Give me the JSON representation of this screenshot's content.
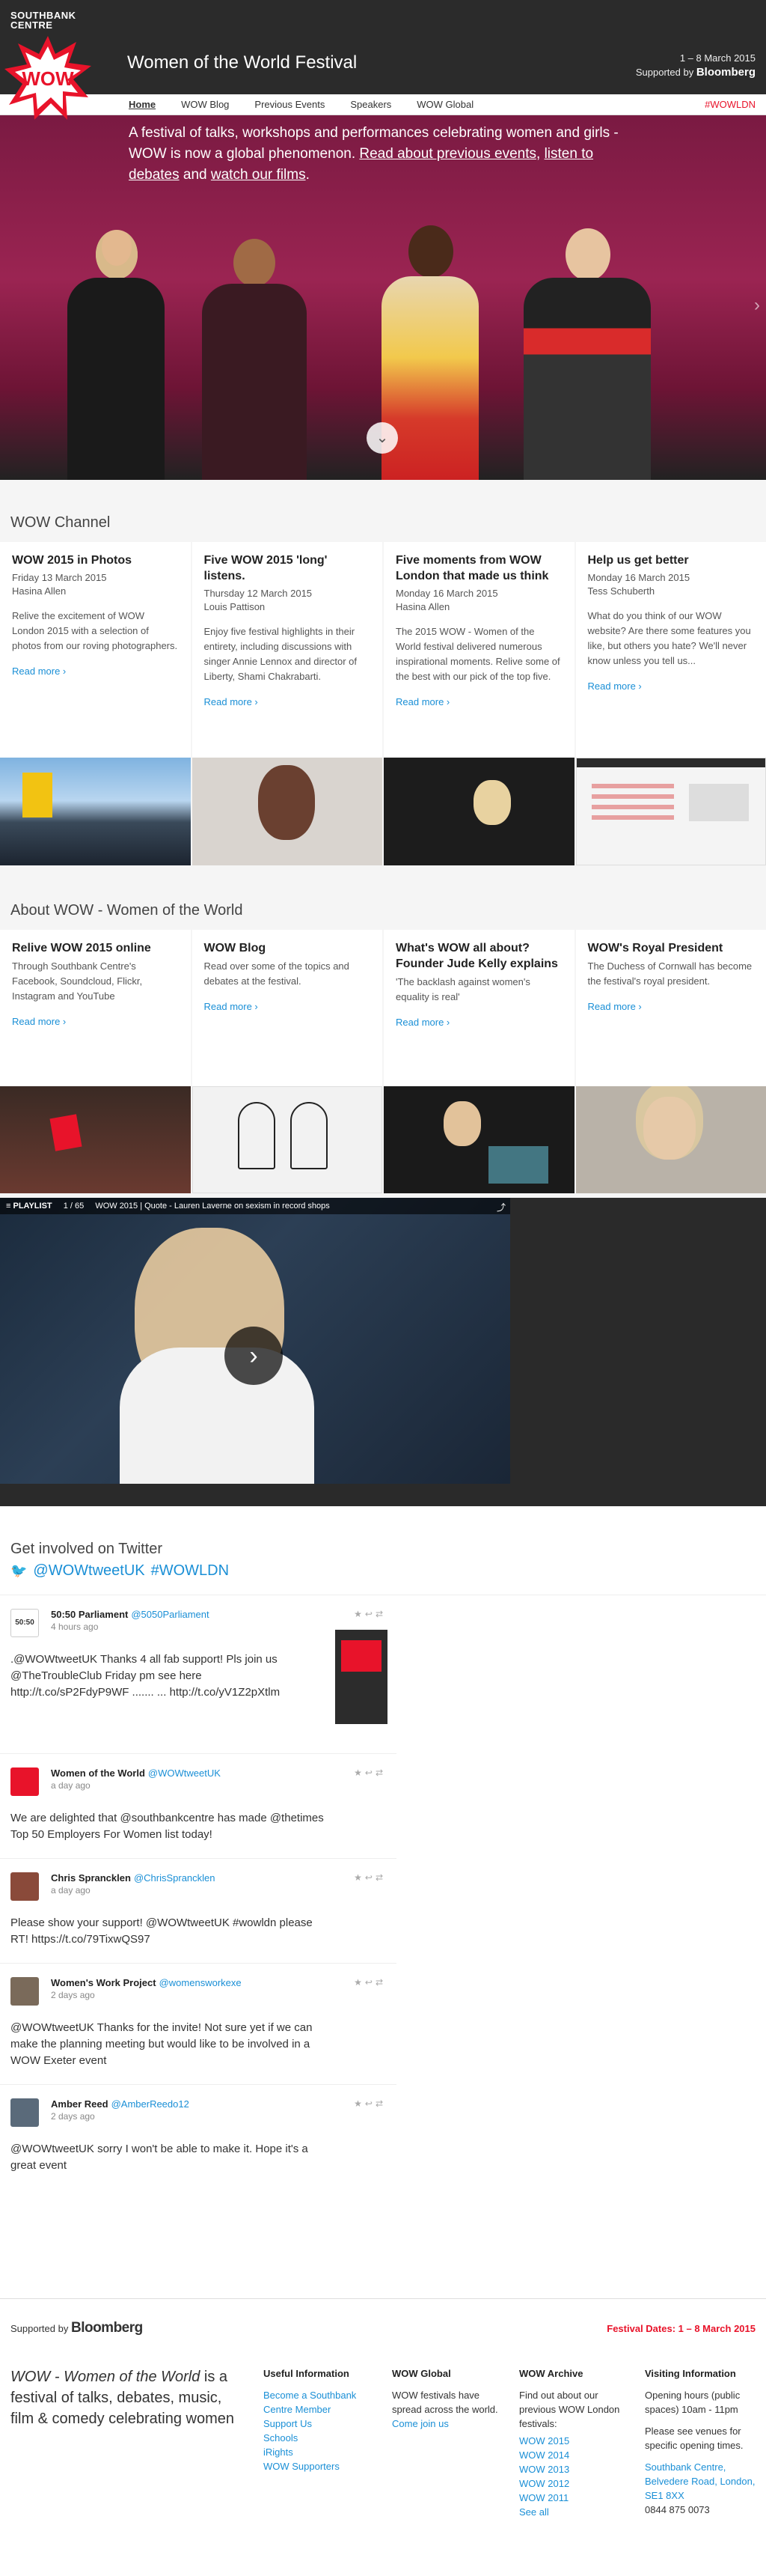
{
  "header": {
    "southbank_logo": "SOUTHBANK CENTRE",
    "wow_logo": "WOW",
    "title": "Women of the World Festival",
    "dates": "1 – 8 March 2015",
    "supported_by": "Supported by",
    "sponsor": "Bloomberg"
  },
  "nav": {
    "items": [
      "Home",
      "WOW Blog",
      "Previous Events",
      "Speakers",
      "WOW Global"
    ],
    "hashtag": "#WOWLDN"
  },
  "hero": {
    "text_1": "A festival of talks, workshops and performances celebrating women and girls - WOW is now a global phenomenon. ",
    "link_1": "Read about previous events",
    "text_2": ", ",
    "link_2": "listen to debates",
    "text_3": " and ",
    "link_3": "watch our films",
    "text_4": "."
  },
  "channel": {
    "title": "WOW Channel",
    "cards": [
      {
        "title": "WOW 2015 in Photos",
        "date": "Friday 13 March 2015",
        "author": "Hasina Allen",
        "text": "Relive the excitement of WOW London 2015 with a selection of photos from our roving photographers.",
        "more": "Read more"
      },
      {
        "title": "Five WOW 2015 'long' listens.",
        "date": "Thursday 12 March 2015",
        "author": "Louis Pattison",
        "text": "Enjoy five festival highlights in their entirety, including discussions with singer Annie Lennox and director of Liberty, Shami Chakrabarti.",
        "more": "Read more"
      },
      {
        "title": "Five moments from WOW London that made us think",
        "date": "Monday 16 March 2015",
        "author": "Hasina Allen",
        "text": "The 2015 WOW - Women of the World festival delivered numerous inspirational moments. Relive some of the best with our pick of the top five.",
        "more": "Read more"
      },
      {
        "title": "Help us get better",
        "date": "Monday 16 March 2015",
        "author": "Tess Schuberth",
        "text": "What do you think of our WOW website? Are there some features you like, but others you hate? We'll never know unless you tell us...",
        "more": "Read more"
      }
    ]
  },
  "about": {
    "title": "About WOW - Women of the World",
    "cards": [
      {
        "title": "Relive WOW 2015 online",
        "text": "Through Southbank Centre's Facebook, Soundcloud, Flickr, Instagram and YouTube",
        "more": "Read more"
      },
      {
        "title": "WOW Blog",
        "text": "Read over some of the topics and debates at the festival.",
        "more": "Read more"
      },
      {
        "title": "What's WOW all about? Founder Jude Kelly explains",
        "text": "'The backlash against women's equality is real'",
        "more": "Read more"
      },
      {
        "title": "WOW's Royal President",
        "text": "The Duchess of Cornwall has become the festival's royal president.",
        "more": "Read more"
      }
    ]
  },
  "video": {
    "playlist": "PLAYLIST",
    "count": "1 / 65",
    "title": "WOW 2015 | Quote - Lauren Laverne on sexism in record shops"
  },
  "twitter": {
    "title": "Get involved on Twitter",
    "tag_1": "@WOWtweetUK",
    "tag_2": "#WOWLDN",
    "tweets": [
      {
        "name": "50:50 Parliament",
        "handle": "@5050Parliament",
        "time": "4 hours ago",
        "text": ".@WOWtweetUK Thanks 4 all fab support! Pls join us @TheTroubleClub Friday pm see here http://t.co/sP2FdyP9WF ....... ... http://t.co/yV1Z2pXtlm"
      },
      {
        "name": "Women of the World",
        "handle": "@WOWtweetUK",
        "time": "a day ago",
        "text": "We are delighted that @southbankcentre has made @thetimes Top 50 Employers For Women list today!"
      },
      {
        "name": "Chris Sprancklen",
        "handle": "@ChrisSprancklen",
        "time": "a day ago",
        "text": "Please show your support! @WOWtweetUK #wowldn please RT! https://t.co/79TixwQS97"
      },
      {
        "name": "Women's Work Project",
        "handle": "@womensworkexe",
        "time": "2 days ago",
        "text": "@WOWtweetUK Thanks for the invite! Not sure yet if we can make the planning meeting but would like to be involved in a WOW Exeter event"
      },
      {
        "name": "Amber Reed",
        "handle": "@AmberReedo12",
        "time": "2 days ago",
        "text": "@WOWtweetUK sorry I won't be able to make it. Hope it's a great event"
      }
    ]
  },
  "footer": {
    "supported_by": "Supported by",
    "sponsor": "Bloomberg",
    "festival_dates": "Festival Dates: 1 – 8 March 2015",
    "intro_em": "WOW - Women of the World",
    "intro_rest": " is a festival of talks, debates, music, film & comedy celebrating women",
    "useful": {
      "heading": "Useful Information",
      "links": [
        "Become a Southbank Centre Member",
        "Support Us",
        "Schools",
        "iRights",
        "WOW Supporters"
      ]
    },
    "global": {
      "heading": "WOW Global",
      "text": "WOW festivals have spread across the world.",
      "link": "Come join us"
    },
    "archive": {
      "heading": "WOW Archive",
      "text": "Find out about our previous WOW London festivals:",
      "links": [
        "WOW 2015",
        "WOW 2014",
        "WOW 2013",
        "WOW 2012",
        "WOW 2011",
        "See all"
      ]
    },
    "visiting": {
      "heading": "Visiting Information",
      "hours": "Opening hours (public spaces) 10am - 11pm",
      "venues": "Please see venues for specific opening times.",
      "address": "Southbank Centre, Belvedere Road, London, SE1 8XX",
      "phone": "0844 875 0073"
    }
  }
}
